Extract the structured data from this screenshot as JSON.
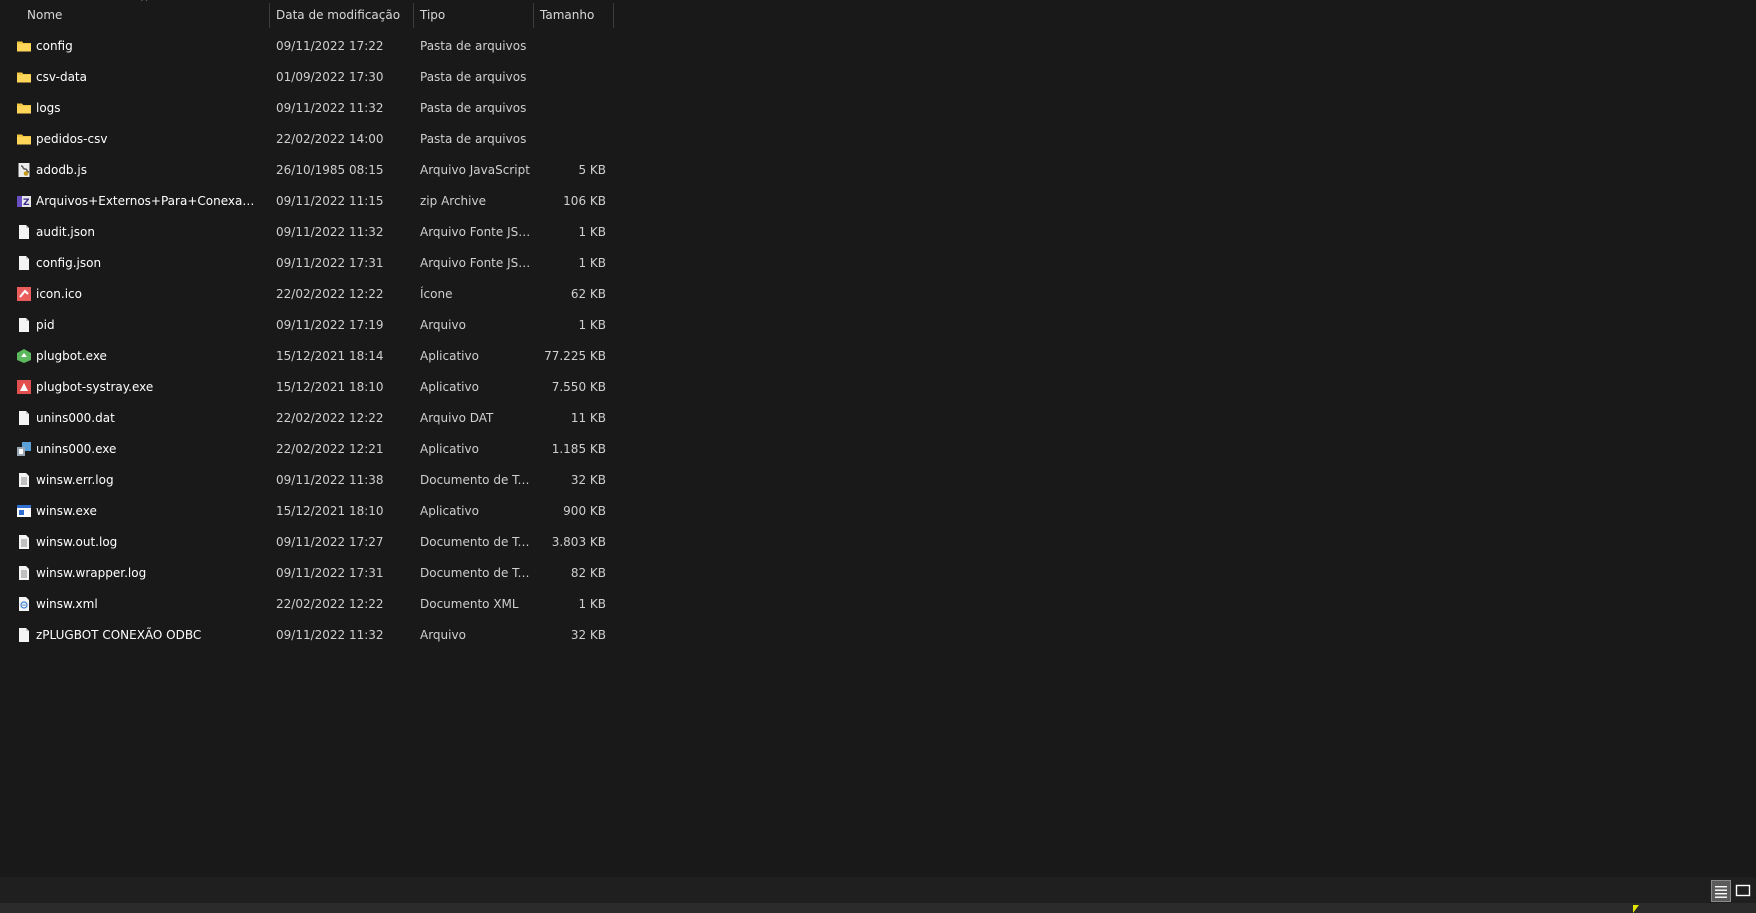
{
  "header": {
    "name_label": "Nome",
    "date_label": "Data de modificação",
    "type_label": "Tipo",
    "size_label": "Tamanho",
    "sort_indicator": "^"
  },
  "files": [
    {
      "name": "config",
      "date": "09/11/2022 17:22",
      "type": "Pasta de arquivos",
      "size": "",
      "icon": "folder-icon"
    },
    {
      "name": "csv-data",
      "date": "01/09/2022 17:30",
      "type": "Pasta de arquivos",
      "size": "",
      "icon": "folder-icon"
    },
    {
      "name": "logs",
      "date": "09/11/2022 11:32",
      "type": "Pasta de arquivos",
      "size": "",
      "icon": "folder-icon"
    },
    {
      "name": "pedidos-csv",
      "date": "22/02/2022 14:00",
      "type": "Pasta de arquivos",
      "size": "",
      "icon": "folder-icon"
    },
    {
      "name": "adodb.js",
      "date": "26/10/1985 08:15",
      "type": "Arquivo JavaScript",
      "size": "5 KB",
      "icon": "javascript-file-icon"
    },
    {
      "name": "Arquivos+Externos+Para+Conexao+OD...",
      "date": "09/11/2022 11:15",
      "type": "zip Archive",
      "size": "106 KB",
      "icon": "zip-archive-icon"
    },
    {
      "name": "audit.json",
      "date": "09/11/2022 11:32",
      "type": "Arquivo Fonte JSON",
      "size": "1 KB",
      "icon": "json-file-icon"
    },
    {
      "name": "config.json",
      "date": "09/11/2022 17:31",
      "type": "Arquivo Fonte JSON",
      "size": "1 KB",
      "icon": "json-file-icon"
    },
    {
      "name": "icon.ico",
      "date": "22/02/2022 12:22",
      "type": "Ícone",
      "size": "62 KB",
      "icon": "ico-file-icon"
    },
    {
      "name": "pid",
      "date": "09/11/2022 17:19",
      "type": "Arquivo",
      "size": "1 KB",
      "icon": "blank-file-icon"
    },
    {
      "name": "plugbot.exe",
      "date": "15/12/2021 18:14",
      "type": "Aplicativo",
      "size": "77.225 KB",
      "icon": "plugbot-app-icon"
    },
    {
      "name": "plugbot-systray.exe",
      "date": "15/12/2021 18:10",
      "type": "Aplicativo",
      "size": "7.550 KB",
      "icon": "plugbot-systray-app-icon"
    },
    {
      "name": "unins000.dat",
      "date": "22/02/2022 12:22",
      "type": "Arquivo DAT",
      "size": "11 KB",
      "icon": "blank-file-icon"
    },
    {
      "name": "unins000.exe",
      "date": "22/02/2022 12:21",
      "type": "Aplicativo",
      "size": "1.185 KB",
      "icon": "uninstaller-app-icon"
    },
    {
      "name": "winsw.err.log",
      "date": "09/11/2022 11:38",
      "type": "Documento de Te...",
      "size": "32 KB",
      "icon": "text-document-icon"
    },
    {
      "name": "winsw.exe",
      "date": "15/12/2021 18:10",
      "type": "Aplicativo",
      "size": "900 KB",
      "icon": "window-app-icon"
    },
    {
      "name": "winsw.out.log",
      "date": "09/11/2022 17:27",
      "type": "Documento de Te...",
      "size": "3.803 KB",
      "icon": "text-document-icon"
    },
    {
      "name": "winsw.wrapper.log",
      "date": "09/11/2022 17:31",
      "type": "Documento de Te...",
      "size": "82 KB",
      "icon": "text-document-icon"
    },
    {
      "name": "winsw.xml",
      "date": "22/02/2022 12:22",
      "type": "Documento XML",
      "size": "1 KB",
      "icon": "xml-document-icon"
    },
    {
      "name": "zPLUGBOT CONEXÃO ODBC",
      "date": "09/11/2022 11:32",
      "type": "Arquivo",
      "size": "32 KB",
      "icon": "blank-file-icon"
    }
  ],
  "colors": {
    "background": "#191919",
    "folder": "#f2c744",
    "text": "#ffffff",
    "secondary_text": "#cfcfcf"
  }
}
